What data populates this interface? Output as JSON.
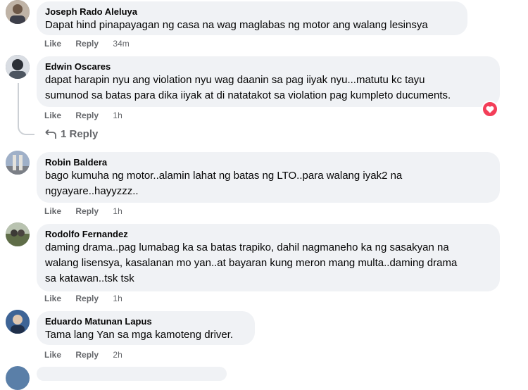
{
  "comments": [
    {
      "author": "Joseph Rado Aleluya",
      "lines": [
        "Dapat hind pinapayagan ng casa na wag maglabas ng motor ang walang lesinsya"
      ],
      "like": "Like",
      "reply": "Reply",
      "time": "34m",
      "avatar_color": "#7a6a5e"
    },
    {
      "author": "Edwin Oscares",
      "lines": [
        "dapat harapin nyu ang violation nyu wag daanin sa pag iiyak nyu...matutu kc tayu",
        "sumunod sa batas para dika iiyak at di natatakot sa violation pag kumpleto ducuments."
      ],
      "like": "Like",
      "reply": "Reply",
      "time": "1h",
      "avatar_color": "#556070",
      "reaction": "heart-reaction",
      "view_replies": "1 Reply"
    },
    {
      "author": "Robin Baldera",
      "lines": [
        "bago kumuha ng motor..alamin lahat ng batas ng LTO..para walang iyak2 na",
        "ngyayare..hayyzzz.."
      ],
      "like": "Like",
      "reply": "Reply",
      "time": "1h",
      "avatar_color": "#8a93a8"
    },
    {
      "author": "Rodolfo Fernandez",
      "lines": [
        "daming drama..pag lumabag ka sa batas trapiko, dahil nagmaneho ka ng sasakyan na",
        "walang lisensya, kasalanan mo yan..at bayaran kung meron mang multa..daming drama",
        "sa katawan..tsk tsk"
      ],
      "like": "Like",
      "reply": "Reply",
      "time": "1h",
      "avatar_color": "#6b7a5a"
    },
    {
      "author": "Eduardo Matunan Lapus",
      "lines": [
        "Tama lang Yan sa mga kamoteng driver."
      ],
      "like": "Like",
      "reply": "Reply",
      "time": "2h",
      "avatar_color": "#4a6f9a"
    }
  ]
}
